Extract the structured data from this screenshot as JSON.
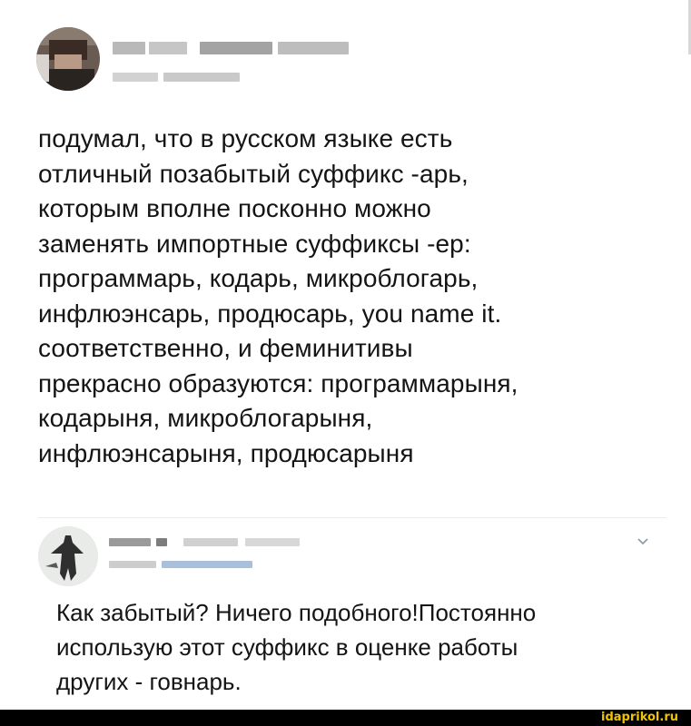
{
  "tweet": {
    "author_name": "",
    "author_handle": "",
    "text_lines": [
      "подумал, что в русском языке есть",
      "отличный позабытый суффикс -арь,",
      "которым вполне посконно можно",
      "заменять импортные суффиксы -ер:",
      "программарь, кодарь, микроблогарь,",
      "инфлюэнсарь, продюсарь, you name it.",
      "соответственно, и феминитивы",
      "прекрасно образуются: программарыня,",
      "кодарыня, микроблогарыня,",
      "инфлюэнсарыня, продюсарыня"
    ]
  },
  "reply": {
    "author_name": "",
    "author_handle": "",
    "menu_icon": "chevron-down-icon",
    "text_lines": [
      "Как забытый? Ничего подобного!Постоянно",
      "использую этот суффикс в оценке работы",
      "других - говнарь."
    ]
  },
  "watermark": {
    "text": "idaprikol.ru",
    "color": "#f2c400"
  },
  "colors": {
    "text": "#141414",
    "divider": "#e6ecf0",
    "blur_gray": "#b4b4b4",
    "blur_blue": "#9fb6d8"
  }
}
